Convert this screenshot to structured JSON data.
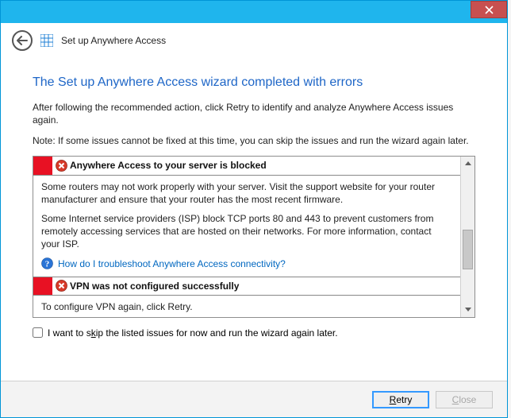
{
  "window": {
    "title": "Set up Anywhere Access"
  },
  "page": {
    "heading": "The Set up Anywhere Access wizard completed with errors",
    "intro": "After following the recommended action, click Retry to identify and analyze Anywhere Access issues again.",
    "note": "Note: If some issues cannot be fixed at this time, you can skip the issues and run the wizard again later."
  },
  "issues": [
    {
      "title": "Anywhere Access to your server is blocked",
      "body_p1": "Some routers may not work properly with your server. Visit the support website for your router manufacturer and ensure that your router has the most recent firmware.",
      "body_p2": "Some Internet service providers (ISP) block TCP ports 80 and 443 to prevent customers from remotely accessing services that are hosted on their networks. For more information, contact your ISP.",
      "help_link": "How do I troubleshoot Anywhere Access connectivity?"
    },
    {
      "title": "VPN was not configured successfully",
      "body_p1": "To configure VPN again, click Retry."
    }
  ],
  "skip": {
    "label_before": "I want to s",
    "label_mnemonic": "k",
    "label_after": "ip the listed issues for now and run the wizard again later."
  },
  "buttons": {
    "retry_mnemonic": "R",
    "retry_rest": "etry",
    "close_mnemonic": "C",
    "close_rest": "lose"
  }
}
